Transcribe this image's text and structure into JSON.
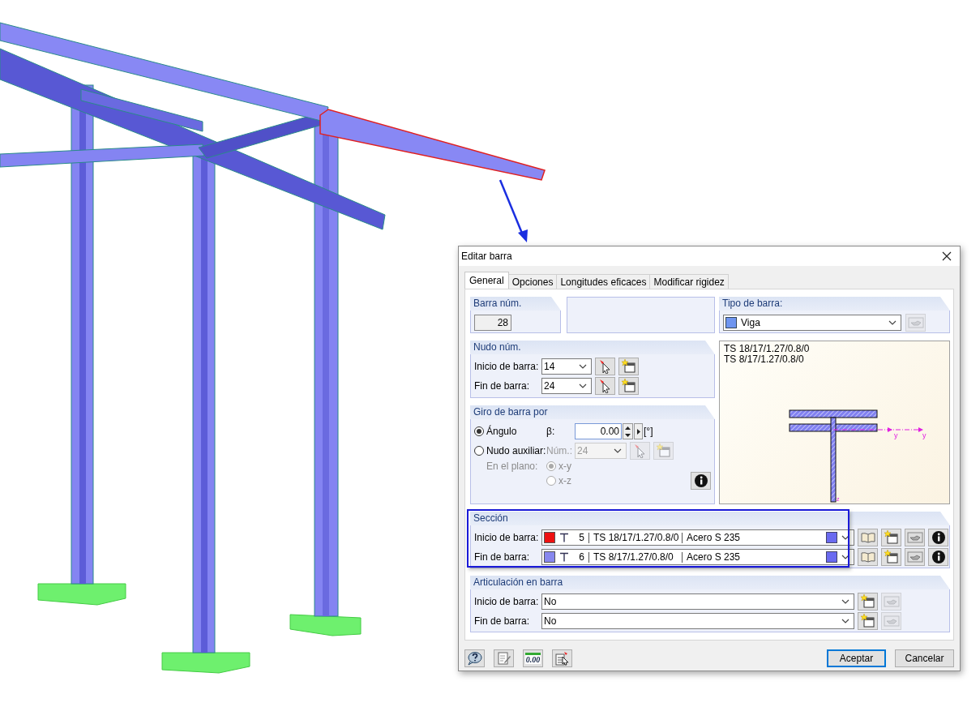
{
  "dialog": {
    "title": "Editar barra",
    "tabs": [
      {
        "label": "General",
        "selected": true
      },
      {
        "label": "Opciones",
        "selected": false
      },
      {
        "label": "Longitudes eficaces",
        "selected": false
      },
      {
        "label": "Modificar rigidez",
        "selected": false
      }
    ],
    "member_no": {
      "label": "Barra núm.",
      "value": "28"
    },
    "member_type": {
      "label": "Tipo de barra:",
      "value": "Viga"
    },
    "nodes": {
      "label": "Nudo núm.",
      "rows": [
        {
          "label": "Inicio de barra:",
          "value": "14"
        },
        {
          "label": "Fin de barra:",
          "value": "24"
        }
      ]
    },
    "preview": {
      "lines": [
        "TS 18/17/1.27/0.8/0",
        "TS 8/17/1.27/0.8/0"
      ],
      "axis_labels": [
        "y",
        "y",
        "z"
      ]
    },
    "rotation": {
      "label": "Giro de barra por",
      "beta_label": "β:",
      "beta_value": "0.00",
      "unit": "[°]",
      "node_label": "Núm.:",
      "node_value": "24",
      "node_disabled": true,
      "plane_label": "En el plano:",
      "options": [
        {
          "label": "Ángulo",
          "selected": true
        },
        {
          "label": "Nudo auxiliar:",
          "selected": false
        }
      ],
      "planes": [
        {
          "label": "x-y",
          "selected": true
        },
        {
          "label": "x-z",
          "selected": false
        }
      ]
    },
    "section": {
      "label": "Sección",
      "highlighted": true,
      "rows": [
        {
          "label": "Inicio de barra:",
          "color": "#ee1111",
          "number": "5",
          "name": "TS 18/17/1.27/0.8/0",
          "material": "Acero S 235"
        },
        {
          "label": "Fin de barra:",
          "color": "#8888ee",
          "number": "6",
          "name": "TS 8/17/1.27/0.8/0",
          "material": "Acero S 235"
        }
      ]
    },
    "hinges": {
      "label": "Articulación en barra",
      "rows": [
        {
          "label": "Inicio de barra:",
          "value": "No"
        },
        {
          "label": "Fin de barra:",
          "value": "No"
        }
      ]
    },
    "units_button": "0.00",
    "buttons": [
      {
        "label": "Aceptar",
        "default": true
      },
      {
        "label": "Cancelar",
        "default": false
      }
    ]
  }
}
